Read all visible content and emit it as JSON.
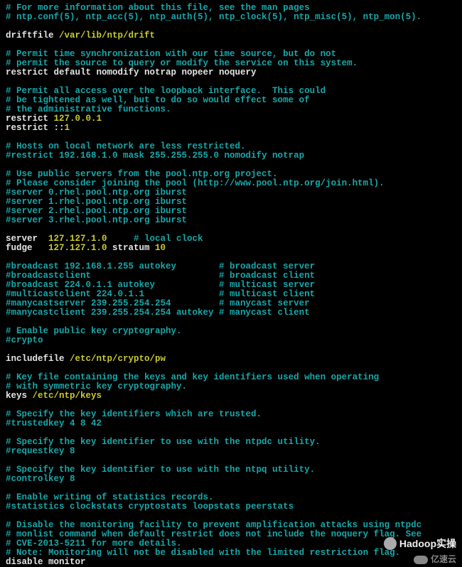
{
  "lines": [
    {
      "t": "comment",
      "v": "# For more information about this file, see the man pages"
    },
    {
      "t": "comment",
      "v": "# ntp.conf(5), ntp_acc(5), ntp_auth(5), ntp_clock(5), ntp_misc(5), ntp_mon(5)."
    },
    {
      "t": "blank",
      "v": ""
    },
    {
      "t": "mixed",
      "parts": [
        {
          "c": "white",
          "v": "driftfile "
        },
        {
          "c": "yellow",
          "v": "/var/lib/ntp/drift"
        }
      ]
    },
    {
      "t": "blank",
      "v": ""
    },
    {
      "t": "comment",
      "v": "# Permit time synchronization with our time source, but do not"
    },
    {
      "t": "comment",
      "v": "# permit the source to query or modify the service on this system."
    },
    {
      "t": "mixed",
      "parts": [
        {
          "c": "white",
          "v": "restrict default nomodify notrap nopeer noquery"
        }
      ]
    },
    {
      "t": "blank",
      "v": ""
    },
    {
      "t": "comment",
      "v": "# Permit all access over the loopback interface.  This could"
    },
    {
      "t": "comment",
      "v": "# be tightened as well, but to do so would effect some of"
    },
    {
      "t": "comment",
      "v": "# the administrative functions."
    },
    {
      "t": "mixed",
      "parts": [
        {
          "c": "white",
          "v": "restrict "
        },
        {
          "c": "yellow",
          "v": "127.0.0.1"
        }
      ]
    },
    {
      "t": "mixed",
      "parts": [
        {
          "c": "white",
          "v": "restrict ::"
        },
        {
          "c": "yellow",
          "v": "1"
        }
      ]
    },
    {
      "t": "blank",
      "v": ""
    },
    {
      "t": "comment",
      "v": "# Hosts on local network are less restricted."
    },
    {
      "t": "comment",
      "v": "#restrict 192.168.1.0 mask 255.255.255.0 nomodify notrap"
    },
    {
      "t": "blank",
      "v": ""
    },
    {
      "t": "comment",
      "v": "# Use public servers from the pool.ntp.org project."
    },
    {
      "t": "comment",
      "v": "# Please consider joining the pool (http://www.pool.ntp.org/join.html)."
    },
    {
      "t": "comment",
      "v": "#server 0.rhel.pool.ntp.org iburst"
    },
    {
      "t": "comment",
      "v": "#server 1.rhel.pool.ntp.org iburst"
    },
    {
      "t": "comment",
      "v": "#server 2.rhel.pool.ntp.org iburst"
    },
    {
      "t": "comment",
      "v": "#server 3.rhel.pool.ntp.org iburst"
    },
    {
      "t": "blank",
      "v": ""
    },
    {
      "t": "mixed",
      "parts": [
        {
          "c": "white",
          "v": "server  "
        },
        {
          "c": "yellow",
          "v": "127.127.1.0     "
        },
        {
          "c": "comment",
          "v": "# local clock"
        }
      ]
    },
    {
      "t": "mixed",
      "parts": [
        {
          "c": "white",
          "v": "fudge   "
        },
        {
          "c": "yellow",
          "v": "127.127.1.0 "
        },
        {
          "c": "white",
          "v": "stratum "
        },
        {
          "c": "yellow",
          "v": "10"
        }
      ]
    },
    {
      "t": "blank",
      "v": ""
    },
    {
      "t": "comment",
      "v": "#broadcast 192.168.1.255 autokey        # broadcast server"
    },
    {
      "t": "comment",
      "v": "#broadcastclient                        # broadcast client"
    },
    {
      "t": "comment",
      "v": "#broadcast 224.0.1.1 autokey            # multicast server"
    },
    {
      "t": "comment",
      "v": "#multicastclient 224.0.1.1              # multicast client"
    },
    {
      "t": "comment",
      "v": "#manycastserver 239.255.254.254         # manycast server"
    },
    {
      "t": "comment",
      "v": "#manycastclient 239.255.254.254 autokey # manycast client"
    },
    {
      "t": "blank",
      "v": ""
    },
    {
      "t": "comment",
      "v": "# Enable public key cryptography."
    },
    {
      "t": "comment",
      "v": "#crypto"
    },
    {
      "t": "blank",
      "v": ""
    },
    {
      "t": "mixed",
      "parts": [
        {
          "c": "white",
          "v": "includefile "
        },
        {
          "c": "yellow",
          "v": "/etc/ntp/crypto/pw"
        }
      ]
    },
    {
      "t": "blank",
      "v": ""
    },
    {
      "t": "comment",
      "v": "# Key file containing the keys and key identifiers used when operating"
    },
    {
      "t": "comment",
      "v": "# with symmetric key cryptography."
    },
    {
      "t": "mixed",
      "parts": [
        {
          "c": "white",
          "v": "keys "
        },
        {
          "c": "yellow",
          "v": "/etc/ntp/keys"
        }
      ]
    },
    {
      "t": "blank",
      "v": ""
    },
    {
      "t": "comment",
      "v": "# Specify the key identifiers which are trusted."
    },
    {
      "t": "comment",
      "v": "#trustedkey 4 8 42"
    },
    {
      "t": "blank",
      "v": ""
    },
    {
      "t": "comment",
      "v": "# Specify the key identifier to use with the ntpdc utility."
    },
    {
      "t": "comment",
      "v": "#requestkey 8"
    },
    {
      "t": "blank",
      "v": ""
    },
    {
      "t": "comment",
      "v": "# Specify the key identifier to use with the ntpq utility."
    },
    {
      "t": "comment",
      "v": "#controlkey 8"
    },
    {
      "t": "blank",
      "v": ""
    },
    {
      "t": "comment",
      "v": "# Enable writing of statistics records."
    },
    {
      "t": "comment",
      "v": "#statistics clockstats cryptostats loopstats peerstats"
    },
    {
      "t": "blank",
      "v": ""
    },
    {
      "t": "comment",
      "v": "# Disable the monitoring facility to prevent amplification attacks using ntpdc"
    },
    {
      "t": "comment",
      "v": "# monlist command when default restrict does not include the noquery flag. See"
    },
    {
      "t": "comment",
      "v": "# CVE-2013-5211 for more details."
    },
    {
      "t": "comment",
      "v": "# Note: Monitoring will not be disabled with the limited restriction flag."
    },
    {
      "t": "mixed",
      "parts": [
        {
          "c": "white",
          "v": "disable monitor"
        }
      ]
    }
  ],
  "watermark1": "Hadoop实操",
  "watermark2": "亿速云"
}
